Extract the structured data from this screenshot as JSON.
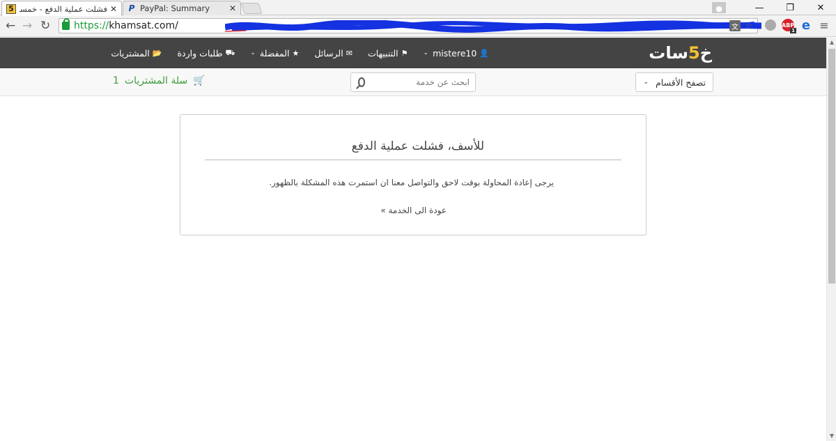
{
  "browser": {
    "tabs": [
      {
        "title": "فشلت عملية الدفع - خمسات",
        "favicon": "5",
        "active": true
      },
      {
        "title": "PayPal: Summary",
        "favicon": "P",
        "active": false
      }
    ],
    "url": {
      "scheme": "https://",
      "host": "khamsat.com/"
    }
  },
  "site": {
    "logo": {
      "prefix": "خ",
      "digit": "5",
      "suffix": "سات"
    },
    "nav": {
      "user": "mistere10",
      "notifications": "التنبيهات",
      "messages": "الرسائل",
      "favorites": "المفضلة",
      "requests": "طلبات واردة",
      "purchases": "المشتريات"
    },
    "subbar": {
      "browse": "تصفح الأقسام",
      "search_placeholder": "ابحث عن خدمة",
      "cart_label": "سلة المشتريات",
      "cart_count": "1"
    },
    "panel": {
      "title": "للأسف، فشلت عملية الدفع",
      "message": "يرجى إعادة المحاولة بوقت لاحق والتواصل معنا ان استمرت هذه المشكلة بالظهور.",
      "back_link": "عودة الى الخدمة »"
    }
  },
  "colors": {
    "nav_bg": "#444444",
    "logo_accent": "#f3c232",
    "cart_green": "#3a9a3a",
    "https_green": "#1a9a3a"
  }
}
